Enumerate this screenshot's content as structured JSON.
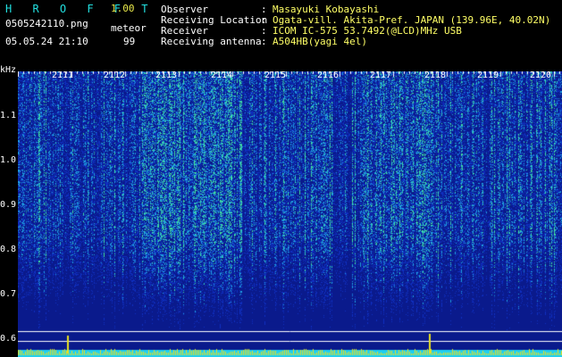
{
  "header": {
    "app_title": "H R O F F T",
    "version": "1.00",
    "filename": "0505242110.png",
    "mode": "meteor",
    "datetime": "05.05.24 21:10",
    "count": "99"
  },
  "station": {
    "rows": [
      {
        "label": "Observer",
        "value": "Masayuki Kobayashi"
      },
      {
        "label": "Receiving Location",
        "value": "Ogata-vill. Akita-Pref. JAPAN (139.96E, 40.02N)"
      },
      {
        "label": "Receiver",
        "value": "ICOM IC-575 53.7492(@LCD)MHz USB"
      },
      {
        "label": "Receiving antenna",
        "value": "A504HB(yagi 4el)"
      }
    ],
    "separator": ":"
  },
  "spectrogram": {
    "y_unit": "kHz",
    "y_ticks": [
      "1.1",
      "1.0",
      "0.9",
      "0.8",
      "0.7",
      "0.6"
    ],
    "x_ticks": [
      "2111",
      "2112",
      "2113",
      "2114",
      "2115",
      "2116",
      "2117",
      "2118",
      "2119",
      "2120"
    ],
    "colors": {
      "background": "#0a1a8c",
      "noise_low": "#1030c0",
      "noise_mid": "#1fa0e0",
      "noise_high": "#40e0a0",
      "hot": "#e8e020",
      "baseline": "#20d0f0",
      "gridline": "#ffffff"
    }
  }
}
